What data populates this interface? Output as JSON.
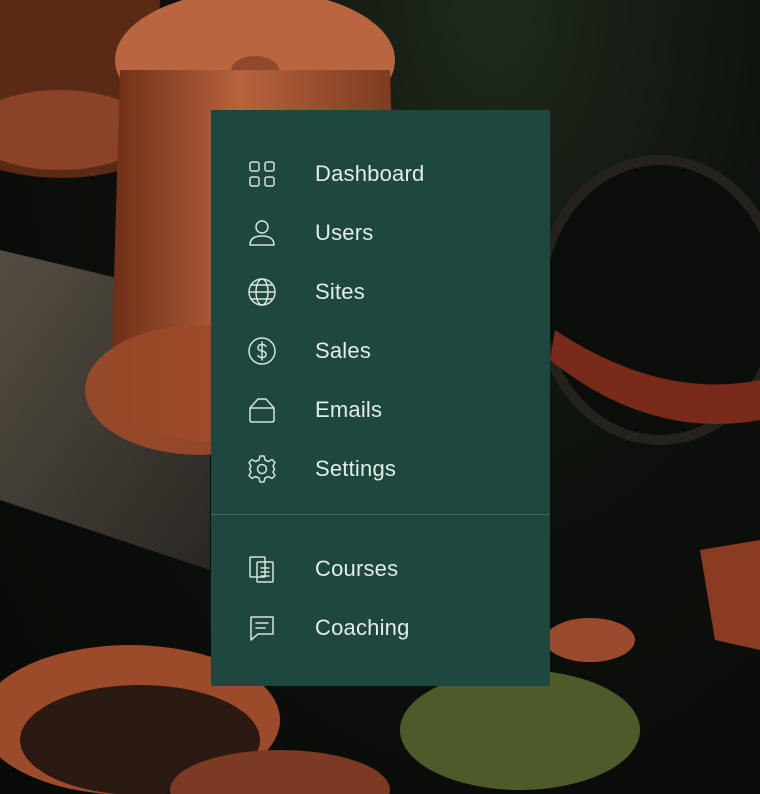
{
  "background": {
    "description_icon": "terracotta-pots-photo-icon"
  },
  "menu": {
    "background_color": "#1e4740",
    "primary_items": [
      {
        "label": "Dashboard",
        "icon": "grid-icon"
      },
      {
        "label": "Users",
        "icon": "user-icon"
      },
      {
        "label": "Sites",
        "icon": "globe-icon"
      },
      {
        "label": "Sales",
        "icon": "dollar-circle-icon"
      },
      {
        "label": "Emails",
        "icon": "inbox-icon"
      },
      {
        "label": "Settings",
        "icon": "gear-icon"
      }
    ],
    "secondary_items": [
      {
        "label": "Courses",
        "icon": "documents-icon"
      },
      {
        "label": "Coaching",
        "icon": "chat-icon"
      }
    ]
  }
}
